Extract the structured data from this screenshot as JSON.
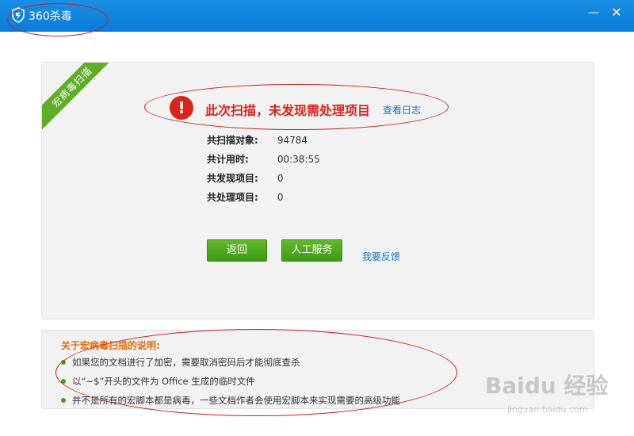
{
  "window": {
    "title": "360杀毒",
    "minimize_icon": "minimize-icon",
    "close_icon": "close-icon"
  },
  "scan": {
    "ribbon_label": "宏病毒扫描",
    "headline": "此次扫描，未发现需处理项目",
    "view_log": "查看日志",
    "stats": [
      {
        "label": "共扫描对象:",
        "value": "94784"
      },
      {
        "label": "共计用时:",
        "value": "00:38:55"
      },
      {
        "label": "共发现项目:",
        "value": "0"
      },
      {
        "label": "共处理项目:",
        "value": "0"
      }
    ],
    "buttons": {
      "back": "返回",
      "service": "人工服务"
    },
    "feedback": "我要反馈"
  },
  "info": {
    "title": "关于宏病毒扫描的说明:",
    "items": [
      "如果您的文档进行了加密，需要取消密码后才能彻底查杀",
      "以“~$”开头的文件为 Office 生成的临时文件",
      "并不是所有的宏脚本都是病毒，一些文档作者会使用宏脚本来实现需要的高级功能"
    ]
  },
  "watermark": {
    "brand": "Baidu 经验",
    "url": "jingyan.baidu.com"
  },
  "colors": {
    "titlebar": "#0b7ad8",
    "alert": "#d9231d",
    "button_green": "#4fa81f",
    "link": "#1a73c8",
    "info_title": "#e96a0a"
  }
}
